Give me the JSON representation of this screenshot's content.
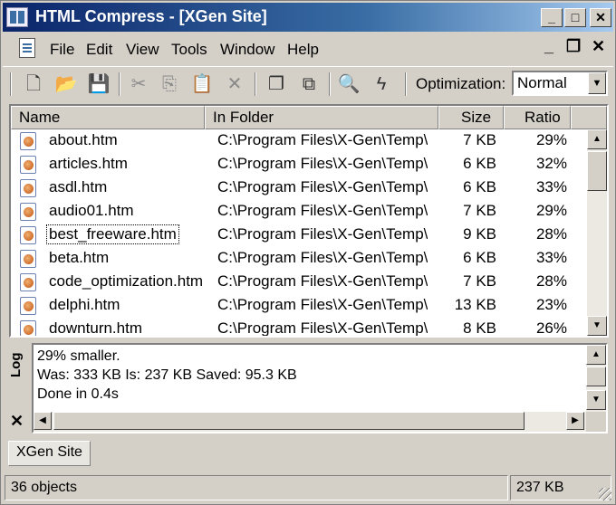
{
  "window": {
    "title": "HTML Compress - [XGen Site]",
    "controls": {
      "minimize": "_",
      "maximize": "□",
      "close": "✕"
    }
  },
  "menubar": {
    "items": [
      "File",
      "Edit",
      "View",
      "Tools",
      "Window",
      "Help"
    ],
    "child_controls": {
      "minimize": "_",
      "restore": "❐",
      "close": "✕"
    }
  },
  "toolbar": {
    "buttons": [
      {
        "name": "new-icon",
        "glyph": "🗋"
      },
      {
        "name": "open-folder-icon",
        "glyph": "📂"
      },
      {
        "name": "save-icon",
        "glyph": "💾"
      },
      {
        "name": "cut-icon",
        "glyph": "✂"
      },
      {
        "name": "copy-icon",
        "glyph": "⎘"
      },
      {
        "name": "paste-icon",
        "glyph": "📋"
      },
      {
        "name": "delete-icon",
        "glyph": "✕"
      },
      {
        "name": "duplicate-icon",
        "glyph": "❐"
      },
      {
        "name": "duplicate-all-icon",
        "glyph": "⧉"
      },
      {
        "name": "preview-icon",
        "glyph": "🔍"
      },
      {
        "name": "compress-icon",
        "glyph": "ϟ"
      }
    ],
    "optimization_label": "Optimization:",
    "optimization_value": "Normal"
  },
  "list": {
    "columns": [
      "Name",
      "In Folder",
      "Size",
      "Ratio"
    ],
    "rows": [
      {
        "name": "about.htm",
        "folder": "C:\\Program Files\\X-Gen\\Temp\\",
        "size": "7 KB",
        "ratio": "29%"
      },
      {
        "name": "articles.htm",
        "folder": "C:\\Program Files\\X-Gen\\Temp\\",
        "size": "6 KB",
        "ratio": "32%"
      },
      {
        "name": "asdl.htm",
        "folder": "C:\\Program Files\\X-Gen\\Temp\\",
        "size": "6 KB",
        "ratio": "33%"
      },
      {
        "name": "audio01.htm",
        "folder": "C:\\Program Files\\X-Gen\\Temp\\",
        "size": "7 KB",
        "ratio": "29%"
      },
      {
        "name": "best_freeware.htm",
        "folder": "C:\\Program Files\\X-Gen\\Temp\\",
        "size": "9 KB",
        "ratio": "28%"
      },
      {
        "name": "beta.htm",
        "folder": "C:\\Program Files\\X-Gen\\Temp\\",
        "size": "6 KB",
        "ratio": "33%"
      },
      {
        "name": "code_optimization.htm",
        "folder": "C:\\Program Files\\X-Gen\\Temp\\",
        "size": "7 KB",
        "ratio": "28%"
      },
      {
        "name": "delphi.htm",
        "folder": "C:\\Program Files\\X-Gen\\Temp\\",
        "size": "13 KB",
        "ratio": "23%"
      },
      {
        "name": "downturn.htm",
        "folder": "C:\\Program Files\\X-Gen\\Temp\\",
        "size": "8 KB",
        "ratio": "26%"
      }
    ]
  },
  "log": {
    "label": "Log",
    "close": "✕",
    "lines": [
      "29% smaller.",
      "Was: 333 KB Is: 237 KB Saved: 95.3 KB",
      "Done in 0.4s"
    ]
  },
  "tabs": [
    "XGen Site"
  ],
  "status": {
    "objects": "36 objects",
    "size": "237 KB"
  },
  "colors": {
    "titlebar_start": "#0a246a",
    "titlebar_end": "#a6caf0",
    "face": "#d4d0c8"
  }
}
